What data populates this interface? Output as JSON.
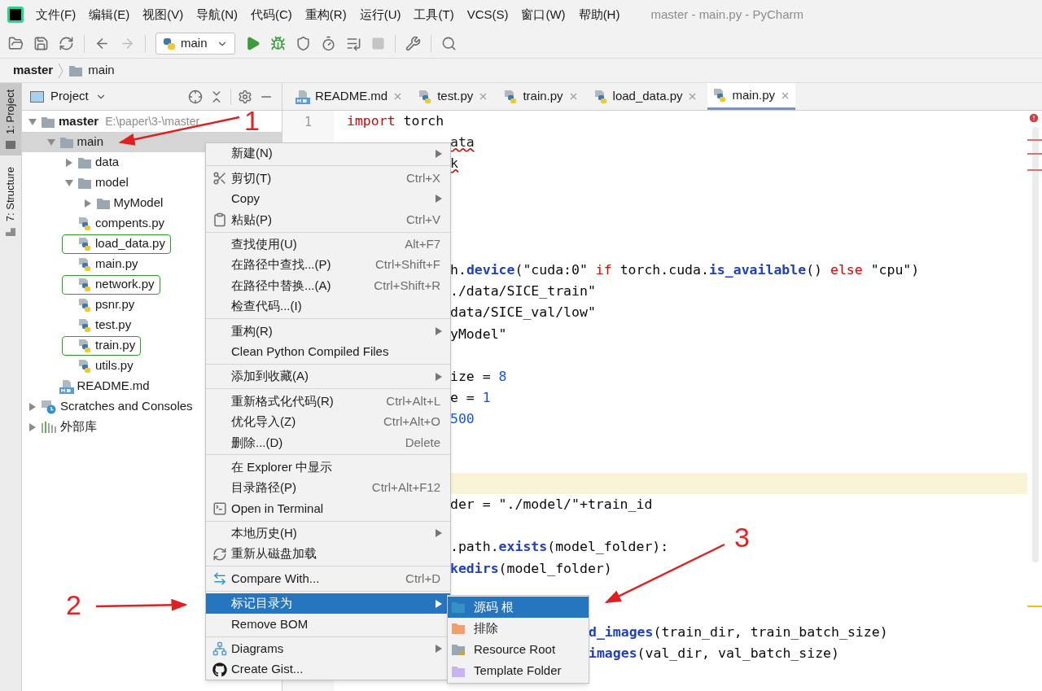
{
  "window": {
    "title": "master - main.py - PyCharm"
  },
  "menu_bar": [
    "文件(F)",
    "编辑(E)",
    "视图(V)",
    "导航(N)",
    "代码(C)",
    "重构(R)",
    "运行(U)",
    "工具(T)",
    "VCS(S)",
    "窗口(W)",
    "帮助(H)"
  ],
  "toolbar": {
    "run_config": "main"
  },
  "breadcrumb": [
    "master",
    "main"
  ],
  "tool_strip": [
    {
      "label": "1: Project",
      "selected": true
    },
    {
      "label": "7: Structure",
      "selected": false
    }
  ],
  "project_panel": {
    "title": "Project",
    "tree": [
      {
        "name": "master",
        "hint": "E:\\paper\\3-\\master",
        "kind": "folder",
        "expanded": true,
        "selected": false,
        "highlighted": false,
        "children": [
          {
            "name": "main",
            "kind": "folder",
            "expanded": true,
            "selected": true,
            "highlighted": false,
            "children": [
              {
                "name": "data",
                "kind": "folder",
                "expanded": false,
                "selected": false,
                "highlighted": false
              },
              {
                "name": "model",
                "kind": "folder",
                "expanded": true,
                "selected": false,
                "highlighted": false,
                "children": [
                  {
                    "name": "MyModel",
                    "kind": "folder",
                    "expanded": false,
                    "selected": false,
                    "highlighted": false
                  }
                ]
              },
              {
                "name": "compents.py",
                "kind": "py",
                "selected": false,
                "highlighted": false
              },
              {
                "name": "load_data.py",
                "kind": "py",
                "selected": false,
                "highlighted": true
              },
              {
                "name": "main.py",
                "kind": "py",
                "selected": false,
                "highlighted": false
              },
              {
                "name": "network.py",
                "kind": "py",
                "selected": false,
                "highlighted": true
              },
              {
                "name": "psnr.py",
                "kind": "py",
                "selected": false,
                "highlighted": false
              },
              {
                "name": "test.py",
                "kind": "py",
                "selected": false,
                "highlighted": false
              },
              {
                "name": "train.py",
                "kind": "py",
                "selected": false,
                "highlighted": true
              },
              {
                "name": "utils.py",
                "kind": "py",
                "selected": false,
                "highlighted": false
              }
            ]
          },
          {
            "name": "README.md",
            "kind": "md",
            "selected": false,
            "highlighted": false
          }
        ]
      },
      {
        "name": "Scratches and Consoles",
        "kind": "scratches",
        "expanded": false,
        "selected": false,
        "highlighted": false
      },
      {
        "name": "外部库",
        "kind": "library",
        "expanded": false,
        "selected": false,
        "highlighted": false
      }
    ]
  },
  "editor": {
    "tabs": [
      {
        "label": "README.md",
        "kind": "md",
        "selected": false
      },
      {
        "label": "test.py",
        "kind": "py",
        "selected": false
      },
      {
        "label": "train.py",
        "kind": "py",
        "selected": false
      },
      {
        "label": "load_data.py",
        "kind": "py",
        "selected": false
      },
      {
        "label": "main.py",
        "kind": "py",
        "selected": true
      }
    ],
    "line_numbers": [
      "1"
    ],
    "lines": [
      {
        "kind": "full",
        "current": false,
        "tokens": [
          {
            "t": "import",
            "kind": "keyword"
          },
          {
            "t": " torch",
            "kind": "plain"
          }
        ]
      },
      {
        "kind": "beside_menu",
        "current": false,
        "tokens": [
          {
            "t": "ata",
            "kind": "error"
          }
        ]
      },
      {
        "kind": "beside_menu",
        "current": false,
        "tokens": [
          {
            "t": "k",
            "kind": "error"
          }
        ]
      },
      {
        "kind": "beside_menu",
        "current": false
      },
      {
        "kind": "beside_menu",
        "current": false
      },
      {
        "kind": "beside_menu",
        "current": false
      },
      {
        "kind": "beside_menu",
        "current": false
      },
      {
        "kind": "beside_menu",
        "current": false,
        "tokens": [
          {
            "t": "h.",
            "kind": "plain"
          },
          {
            "t": "device",
            "kind": "function"
          },
          {
            "t": "(\"cuda:0\" ",
            "kind": "plain"
          },
          {
            "t": "if",
            "kind": "keyword"
          },
          {
            "t": " torch.cuda.",
            "kind": "plain"
          },
          {
            "t": "is_available",
            "kind": "function"
          },
          {
            "t": "() ",
            "kind": "plain"
          },
          {
            "t": "else",
            "kind": "keyword"
          },
          {
            "t": " \"cpu\")",
            "kind": "plain"
          }
        ]
      },
      {
        "kind": "beside_menu",
        "current": false,
        "tokens": [
          {
            "t": "./data/SICE_train\"",
            "kind": "plain"
          }
        ]
      },
      {
        "kind": "beside_menu",
        "current": false,
        "tokens": [
          {
            "t": "data/SICE_val/low\"",
            "kind": "plain"
          }
        ]
      },
      {
        "kind": "beside_menu",
        "current": false,
        "tokens": [
          {
            "t": "yModel\"",
            "kind": "plain"
          }
        ]
      },
      {
        "kind": "beside_menu",
        "current": false
      },
      {
        "kind": "beside_menu",
        "current": false,
        "tokens": [
          {
            "t": "ize = ",
            "kind": "plain"
          },
          {
            "t": "8",
            "kind": "number"
          }
        ]
      },
      {
        "kind": "beside_menu",
        "current": false,
        "tokens": [
          {
            "t": "e = ",
            "kind": "plain"
          },
          {
            "t": "1",
            "kind": "number"
          }
        ]
      },
      {
        "kind": "beside_menu",
        "current": false,
        "tokens": [
          {
            "t": "500",
            "kind": "number"
          }
        ]
      },
      {
        "kind": "beside_menu",
        "current": false
      },
      {
        "kind": "beside_menu",
        "current": false
      },
      {
        "kind": "beside_menu",
        "current": true
      },
      {
        "kind": "beside_menu",
        "current": false,
        "tokens": [
          {
            "t": "der = \"./model/\"+train_id",
            "kind": "plain"
          }
        ]
      },
      {
        "kind": "beside_menu",
        "current": false
      },
      {
        "kind": "beside_menu",
        "current": false,
        "tokens": [
          {
            "t": ".path.",
            "kind": "plain"
          },
          {
            "t": "exists",
            "kind": "function"
          },
          {
            "t": "(model_folder):",
            "kind": "plain"
          }
        ]
      },
      {
        "kind": "beside_menu",
        "current": false,
        "tokens": [
          {
            "t": "kedirs",
            "kind": "function"
          },
          {
            "t": "(model_folder)",
            "kind": "plain"
          }
        ]
      },
      {
        "kind": "beside_menu",
        "current": false
      },
      {
        "kind": "beside_submenu",
        "current": false
      },
      {
        "kind": "beside_submenu",
        "current": false,
        "tokens": [
          {
            "t": "d_images",
            "kind": "function"
          },
          {
            "t": "(train_dir, train_batch_size)",
            "kind": "plain"
          }
        ]
      },
      {
        "kind": "beside_submenu",
        "current": false,
        "tokens": [
          {
            "t": "images",
            "kind": "function"
          },
          {
            "t": "(val_dir, val_batch_size)",
            "kind": "plain"
          }
        ]
      }
    ]
  },
  "context_menu": {
    "groups": [
      [
        {
          "label": "新建(N)",
          "submenu": true,
          "selected": false
        }
      ],
      [
        {
          "label": "剪切(T)",
          "shortcut": "Ctrl+X",
          "submenu": false,
          "selected": false
        },
        {
          "label": "Copy",
          "submenu": true,
          "selected": false
        },
        {
          "label": "粘贴(P)",
          "shortcut": "Ctrl+V",
          "submenu": false,
          "selected": false
        }
      ],
      [
        {
          "label": "查找使用(U)",
          "shortcut": "Alt+F7",
          "submenu": false,
          "selected": false
        },
        {
          "label": "在路径中查找...(P)",
          "shortcut": "Ctrl+Shift+F",
          "submenu": false,
          "selected": false
        },
        {
          "label": "在路径中替换...(A)",
          "shortcut": "Ctrl+Shift+R",
          "submenu": false,
          "selected": false
        },
        {
          "label": "检查代码...(I)",
          "submenu": false,
          "selected": false
        }
      ],
      [
        {
          "label": "重构(R)",
          "submenu": true,
          "selected": false
        },
        {
          "label": "Clean Python Compiled Files",
          "submenu": false,
          "selected": false
        }
      ],
      [
        {
          "label": "添加到收藏(A)",
          "submenu": true,
          "selected": false
        }
      ],
      [
        {
          "label": "重新格式化代码(R)",
          "shortcut": "Ctrl+Alt+L",
          "submenu": false,
          "selected": false
        },
        {
          "label": "优化导入(Z)",
          "shortcut": "Ctrl+Alt+O",
          "submenu": false,
          "selected": false
        },
        {
          "label": "删除...(D)",
          "shortcut": "Delete",
          "submenu": false,
          "selected": false
        }
      ],
      [
        {
          "label": "在 Explorer 中显示",
          "submenu": false,
          "selected": false
        },
        {
          "label": "目录路径(P)",
          "shortcut": "Ctrl+Alt+F12",
          "submenu": false,
          "selected": false
        },
        {
          "label": "Open in Terminal",
          "submenu": false,
          "selected": false
        }
      ],
      [
        {
          "label": "本地历史(H)",
          "submenu": true,
          "selected": false
        },
        {
          "label": "重新从磁盘加载",
          "submenu": false,
          "selected": false
        }
      ],
      [
        {
          "label": "Compare With...",
          "shortcut": "Ctrl+D",
          "submenu": false,
          "selected": false
        }
      ],
      [
        {
          "label": "标记目录为",
          "submenu": true,
          "selected": true
        },
        {
          "label": "Remove BOM",
          "submenu": false,
          "selected": false
        }
      ],
      [
        {
          "label": "Diagrams",
          "submenu": true,
          "selected": false
        },
        {
          "label": "Create Gist...",
          "submenu": false,
          "selected": false
        }
      ]
    ]
  },
  "submenu": [
    {
      "label": "源码 根",
      "color": "#3592c4",
      "kind": "folder",
      "selected": true
    },
    {
      "label": "排除",
      "color": "#f0a070",
      "kind": "folder",
      "selected": false
    },
    {
      "label": "Resource Root",
      "color": "#9aa7b0",
      "kind": "resource",
      "selected": false
    },
    {
      "label": "Template Folder",
      "color": "#c8b4f0",
      "kind": "folder",
      "selected": false
    }
  ],
  "annotations": [
    {
      "label": "1"
    },
    {
      "label": "2"
    },
    {
      "label": "3"
    }
  ]
}
